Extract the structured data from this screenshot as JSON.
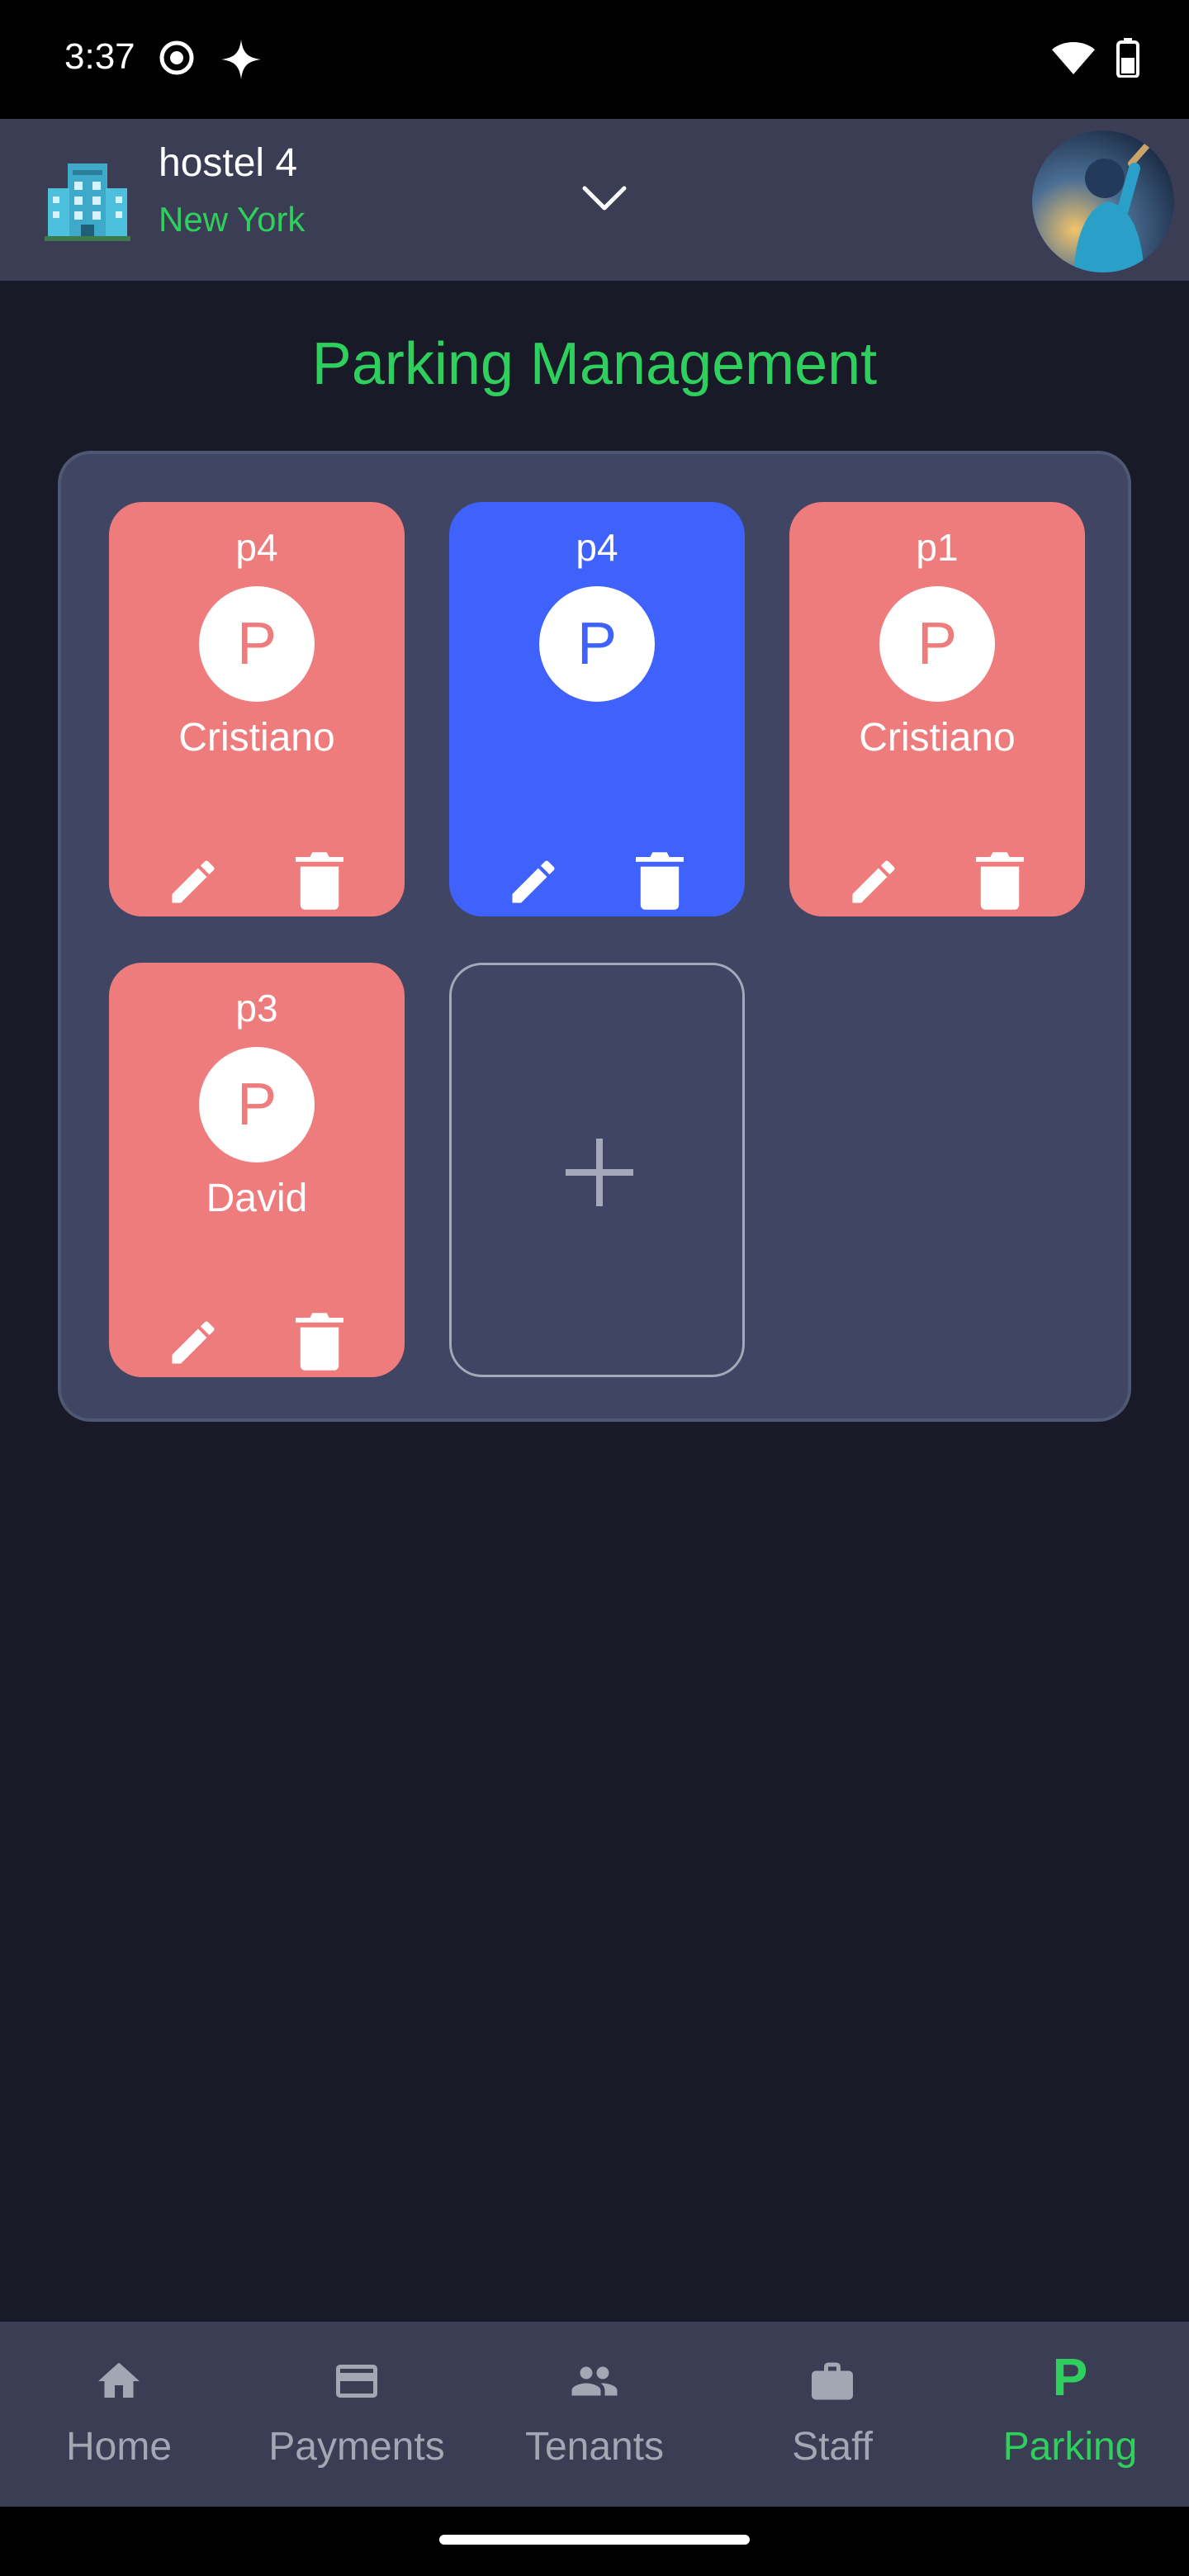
{
  "status_bar": {
    "time": "3:37",
    "icons": [
      "screen-record-icon",
      "sparkle-icon",
      "wifi-icon",
      "battery-icon"
    ]
  },
  "header": {
    "hostel_name": "hostel 4",
    "city": "New York",
    "icons": [
      "building-icon",
      "chevron-down-icon",
      "avatar"
    ]
  },
  "page": {
    "title": "Parking Management"
  },
  "slots": [
    {
      "name": "p4",
      "badge": "P",
      "tenant": "Cristiano",
      "status": "occupied"
    },
    {
      "name": "p4",
      "badge": "P",
      "tenant": "",
      "status": "free"
    },
    {
      "name": "p1",
      "badge": "P",
      "tenant": "Cristiano",
      "status": "occupied"
    },
    {
      "name": "p3",
      "badge": "P",
      "tenant": "David",
      "status": "occupied"
    }
  ],
  "add_slot": {
    "icon": "plus-icon"
  },
  "bottom_nav": {
    "items": [
      {
        "label": "Home",
        "icon": "home-icon"
      },
      {
        "label": "Payments",
        "icon": "credit-card-icon"
      },
      {
        "label": "Tenants",
        "icon": "people-icon"
      },
      {
        "label": "Staff",
        "icon": "briefcase-icon"
      },
      {
        "label": "Parking",
        "icon": "parking-icon"
      }
    ],
    "active": "Parking"
  },
  "colors": {
    "background": "#181a27",
    "header": "#3a3d53",
    "accent_green": "#2fcf5e",
    "occupied": "#ef7c7c",
    "free": "#3f62fd",
    "panel": "#3f4563"
  }
}
